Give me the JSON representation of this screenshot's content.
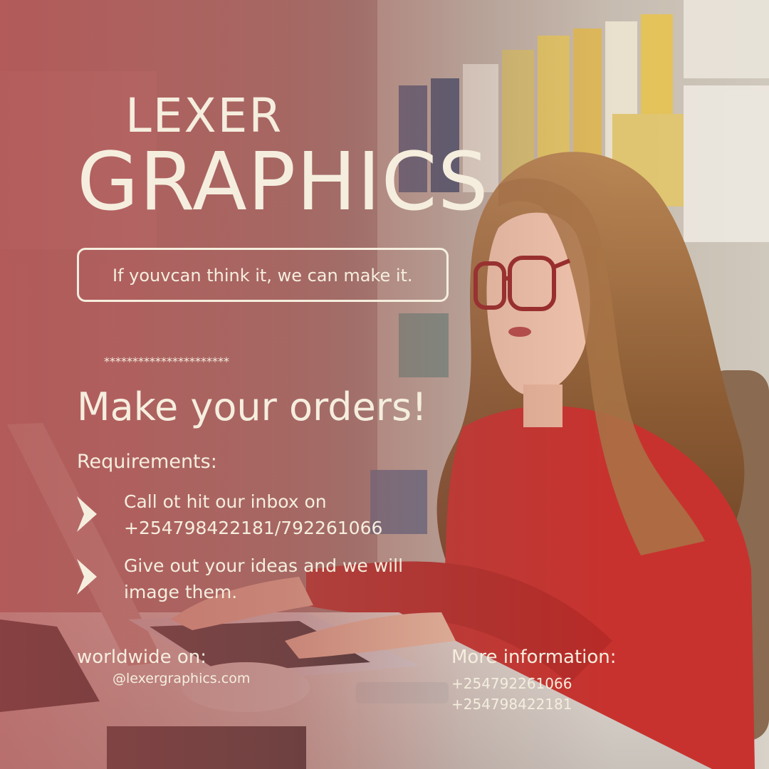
{
  "brand": {
    "line1": "LEXER",
    "line2": "GRAPHICS"
  },
  "tagline": "If youvcan think it, we can make it.",
  "divider_stars": "**********************",
  "headline": "Make your orders!",
  "requirements": {
    "heading": "Requirements:",
    "items": [
      {
        "line1": "Call ot hit our inbox on",
        "line2": "+254798422181/792261066"
      },
      {
        "line1": "Give out your ideas and we will",
        "line2": "image them."
      }
    ]
  },
  "footer": {
    "worldwide_label": "worldwide on:",
    "handle": "@lexergraphics.com",
    "info_label": "More information:",
    "phones": [
      "+254792261066",
      "+254798422181"
    ]
  },
  "colors": {
    "text": "#f5eede",
    "overlay": "#b04e4e",
    "sweater": "#c8322e"
  }
}
